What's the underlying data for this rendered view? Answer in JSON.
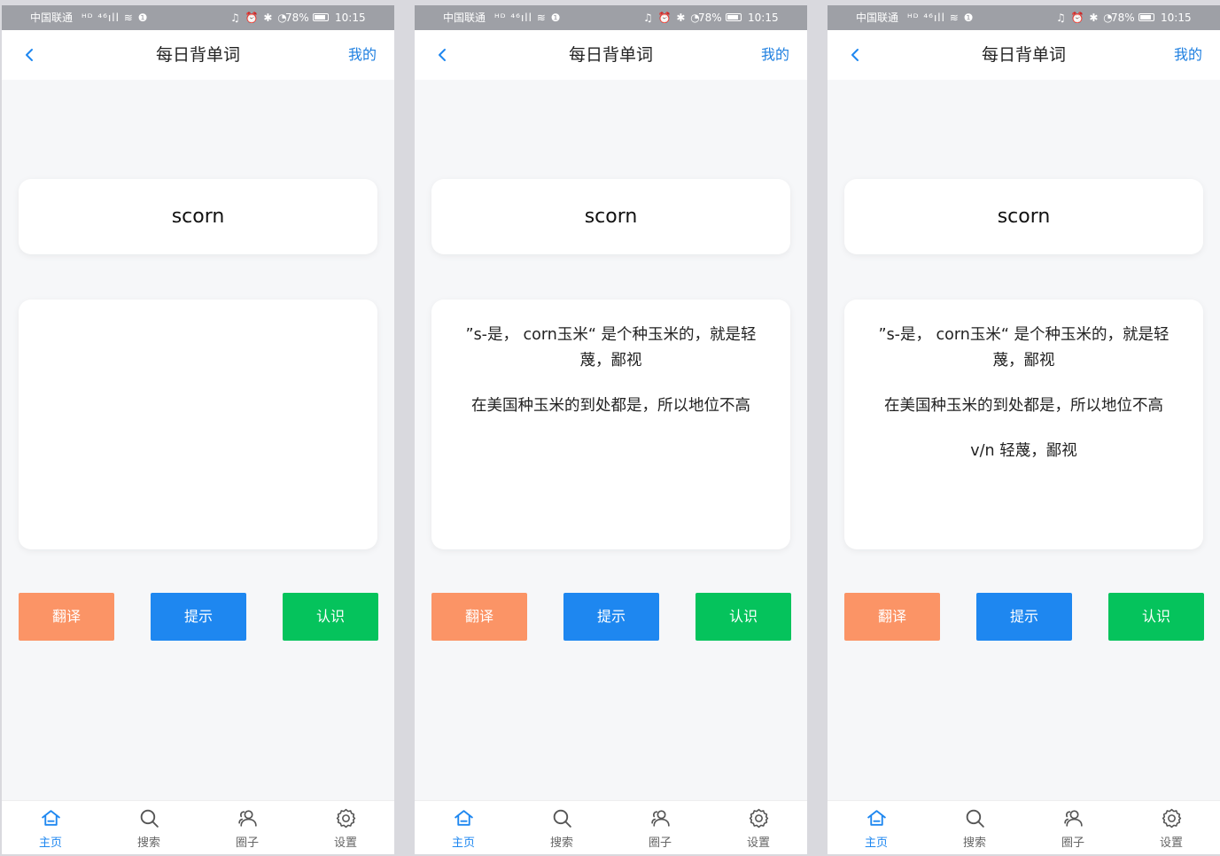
{
  "status_bar": {
    "carrier": "中国联通",
    "left_icons": "ᴴᴰ ⁴⁶ıll ≋ ❶",
    "right_icons": "♫ ⏰ ✱ ◔",
    "battery": "78%",
    "time": "10:15"
  },
  "nav": {
    "title": "每日背单词",
    "mine_link": "我的",
    "back_icon": "chevron-left-icon"
  },
  "word": "scorn",
  "buttons": {
    "translate": "翻译",
    "hint": "提示",
    "know": "认识"
  },
  "tabs": [
    {
      "label": "主页",
      "icon": "home-icon",
      "active": true
    },
    {
      "label": "搜索",
      "icon": "search-icon",
      "active": false
    },
    {
      "label": "圈子",
      "icon": "group-icon",
      "active": false
    },
    {
      "label": "设置",
      "icon": "gear-icon",
      "active": false
    }
  ],
  "screens": [
    {
      "definition_lines": []
    },
    {
      "definition_lines": [
        "”s-是， corn玉米“ 是个种玉米的，就是轻蔑，鄙视",
        "在美国种玉米的到处都是，所以地位不高"
      ]
    },
    {
      "definition_lines": [
        "”s-是， corn玉米“ 是个种玉米的，就是轻蔑，鄙视",
        "在美国种玉米的到处都是，所以地位不高",
        "v/n 轻蔑，鄙视"
      ]
    }
  ],
  "colors": {
    "accent": "#1e87f0",
    "translate_button": "#fb9466",
    "hint_button": "#1e87f0",
    "know_button": "#05c35c",
    "background": "#f6f7f9"
  }
}
